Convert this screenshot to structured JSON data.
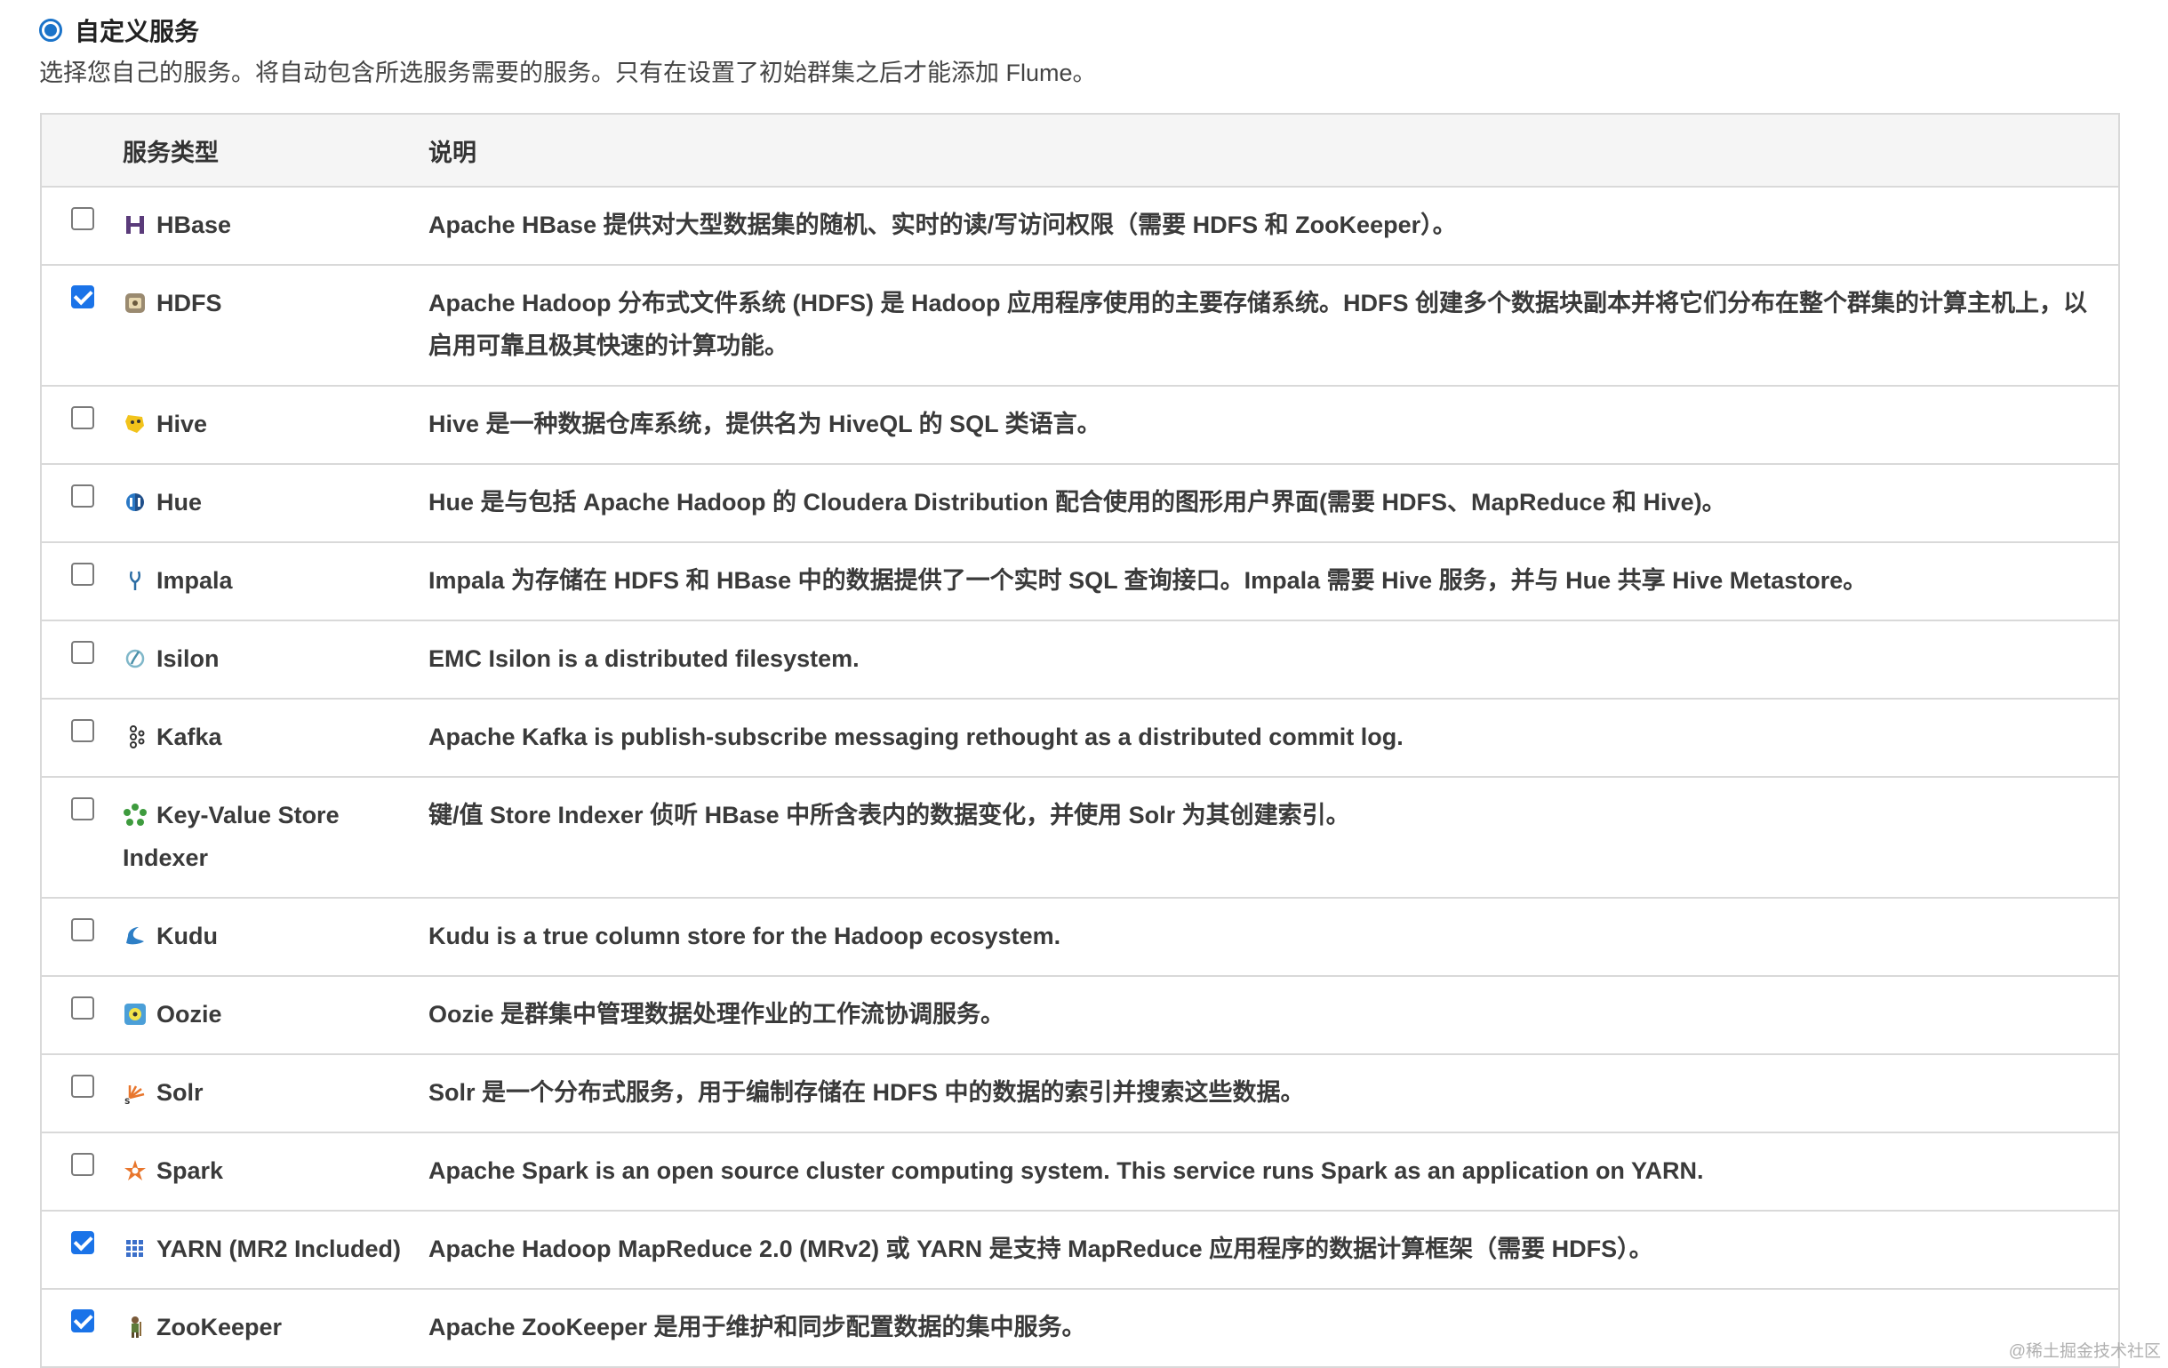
{
  "option": {
    "label": "自定义服务",
    "selected": true
  },
  "intro": "选择您自己的服务。将自动包含所选服务需要的服务。只有在设置了初始群集之后才能添加 Flume。",
  "table": {
    "headers": {
      "type": "服务类型",
      "desc": "说明"
    },
    "rows": [
      {
        "name": "HBase",
        "icon": "hbase-icon",
        "checked": false,
        "desc": "Apache HBase 提供对大型数据集的随机、实时的读/写访问权限（需要 HDFS 和 ZooKeeper）。"
      },
      {
        "name": "HDFS",
        "icon": "hdfs-icon",
        "checked": true,
        "desc": "Apache Hadoop 分布式文件系统 (HDFS) 是 Hadoop 应用程序使用的主要存储系统。HDFS 创建多个数据块副本并将它们分布在整个群集的计算主机上，以启用可靠且极其快速的计算功能。"
      },
      {
        "name": "Hive",
        "icon": "hive-icon",
        "checked": false,
        "desc": "Hive 是一种数据仓库系统，提供名为 HiveQL 的 SQL 类语言。"
      },
      {
        "name": "Hue",
        "icon": "hue-icon",
        "checked": false,
        "desc": "Hue 是与包括 Apache Hadoop 的 Cloudera Distribution 配合使用的图形用户界面(需要 HDFS、MapReduce 和 Hive)。"
      },
      {
        "name": "Impala",
        "icon": "impala-icon",
        "checked": false,
        "desc": "Impala 为存储在 HDFS 和 HBase 中的数据提供了一个实时 SQL 查询接口。Impala 需要 Hive 服务，并与 Hue 共享 Hive Metastore。"
      },
      {
        "name": "Isilon",
        "icon": "isilon-icon",
        "checked": false,
        "desc": "EMC Isilon is a distributed filesystem."
      },
      {
        "name": "Kafka",
        "icon": "kafka-icon",
        "checked": false,
        "desc": "Apache Kafka is publish-subscribe messaging rethought as a distributed commit log."
      },
      {
        "name": "Key-Value Store Indexer",
        "icon": "key-value-store-icon",
        "checked": false,
        "desc": "键/值 Store Indexer 侦听 HBase 中所含表内的数据变化，并使用 Solr 为其创建索引。"
      },
      {
        "name": "Kudu",
        "icon": "kudu-icon",
        "checked": false,
        "desc": "Kudu is a true column store for the Hadoop ecosystem."
      },
      {
        "name": "Oozie",
        "icon": "oozie-icon",
        "checked": false,
        "desc": "Oozie 是群集中管理数据处理作业的工作流协调服务。"
      },
      {
        "name": "Solr",
        "icon": "solr-icon",
        "checked": false,
        "desc": "Solr 是一个分布式服务，用于编制存储在 HDFS 中的数据的索引并搜索这些数据。"
      },
      {
        "name": "Spark",
        "icon": "spark-icon",
        "checked": false,
        "desc": "Apache Spark is an open source cluster computing system. This service runs Spark as an application on YARN."
      },
      {
        "name": "YARN (MR2 Included)",
        "icon": "yarn-icon",
        "checked": true,
        "desc": "Apache Hadoop MapReduce 2.0 (MRv2) 或 YARN 是支持 MapReduce 应用程序的数据计算框架（需要 HDFS）。"
      },
      {
        "name": "ZooKeeper",
        "icon": "zookeeper-icon",
        "checked": true,
        "desc": "Apache ZooKeeper 是用于维护和同步配置数据的集中服务。"
      }
    ]
  },
  "watermark": "@稀土掘金技术社区",
  "colors": {
    "accent": "#1a73e8",
    "border": "#d9d9d9",
    "header_bg": "#f5f5f5"
  }
}
